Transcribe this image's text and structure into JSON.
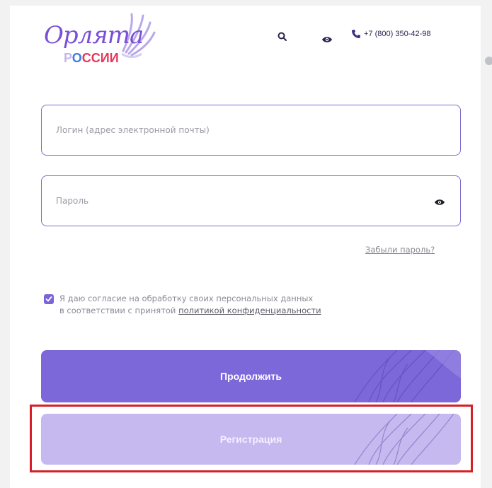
{
  "header": {
    "logo_word": "Орлята",
    "logo_sub_1": "Р",
    "logo_sub_2": "О",
    "logo_sub_3": "ССИИ",
    "phone": "+7 (800) 350-42-98"
  },
  "form": {
    "login_placeholder": "Логин (адрес электронной почты)",
    "password_placeholder": "Пароль",
    "forgot_label": "Забыли пароль?",
    "consent_line1": "Я даю согласие на обработку своих персональных данных",
    "consent_line2_prefix": "в соответствии с принятой ",
    "consent_policy_link": "политикой конфиденциальности",
    "consent_checked": true
  },
  "buttons": {
    "continue_label": "Продолжить",
    "register_label": "Регистрация"
  },
  "colors": {
    "accent": "#7d68da",
    "accent_light": "#c5b9f0",
    "highlight": "#d61f26"
  },
  "icons": [
    "search-icon",
    "eye-icon",
    "phone-icon",
    "checkbox-check-icon",
    "logo-wing-icon"
  ]
}
